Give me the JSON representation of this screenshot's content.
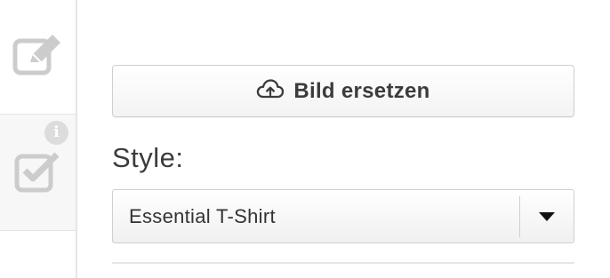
{
  "sidebar": {
    "items": [
      {
        "icon": "edit-icon"
      },
      {
        "icon": "checkbox-icon",
        "badge": "i"
      }
    ]
  },
  "replace_button": {
    "label": "Bild ersetzen",
    "icon": "cloud-upload-icon"
  },
  "style": {
    "label": "Style:",
    "selected": "Essential T-Shirt",
    "dropdown_icon": "caret-down-icon"
  },
  "colors": {
    "text": "#3c3c3c",
    "border": "#cfcfcf",
    "icon_muted": "#cccccc"
  }
}
